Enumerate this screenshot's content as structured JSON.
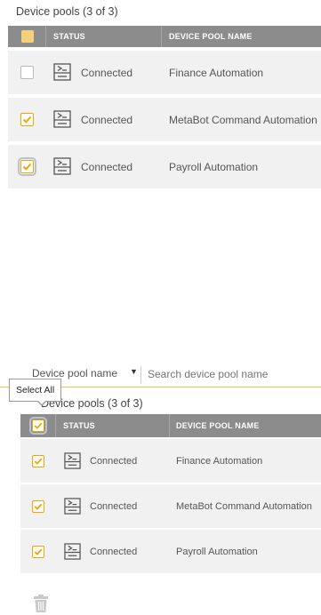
{
  "top_section": {
    "title": "Device pools (3 of 3)",
    "columns": {
      "status": "STATUS",
      "name": "DEVICE POOL NAME"
    },
    "rows": [
      {
        "status": "Connected",
        "name": "Finance Automation",
        "checked": false
      },
      {
        "status": "Connected",
        "name": "MetaBot Command Automation",
        "checked": true
      },
      {
        "status": "Connected",
        "name": "Payroll Automation",
        "checked": true
      }
    ]
  },
  "bottom_section": {
    "filter": {
      "select_value": "Device pool name",
      "search_placeholder": "Search device pool name"
    },
    "tooltip": "Select All",
    "title": "Device pools (3 of 3)",
    "columns": {
      "status": "STATUS",
      "name": "DEVICE POOL NAME"
    },
    "rows": [
      {
        "status": "Connected",
        "name": "Finance Automation",
        "checked": true
      },
      {
        "status": "Connected",
        "name": "MetaBot Command Automation",
        "checked": true
      },
      {
        "status": "Connected",
        "name": "Payroll Automation",
        "checked": true
      }
    ]
  },
  "icons": {
    "status": "device-pool-icon",
    "checkbox": "checkmark-icon",
    "delete": "trash-icon"
  },
  "colors": {
    "accent": "#f2a400",
    "header_bg": "#8c8c8c",
    "row_bg": "#f1f1f1"
  }
}
